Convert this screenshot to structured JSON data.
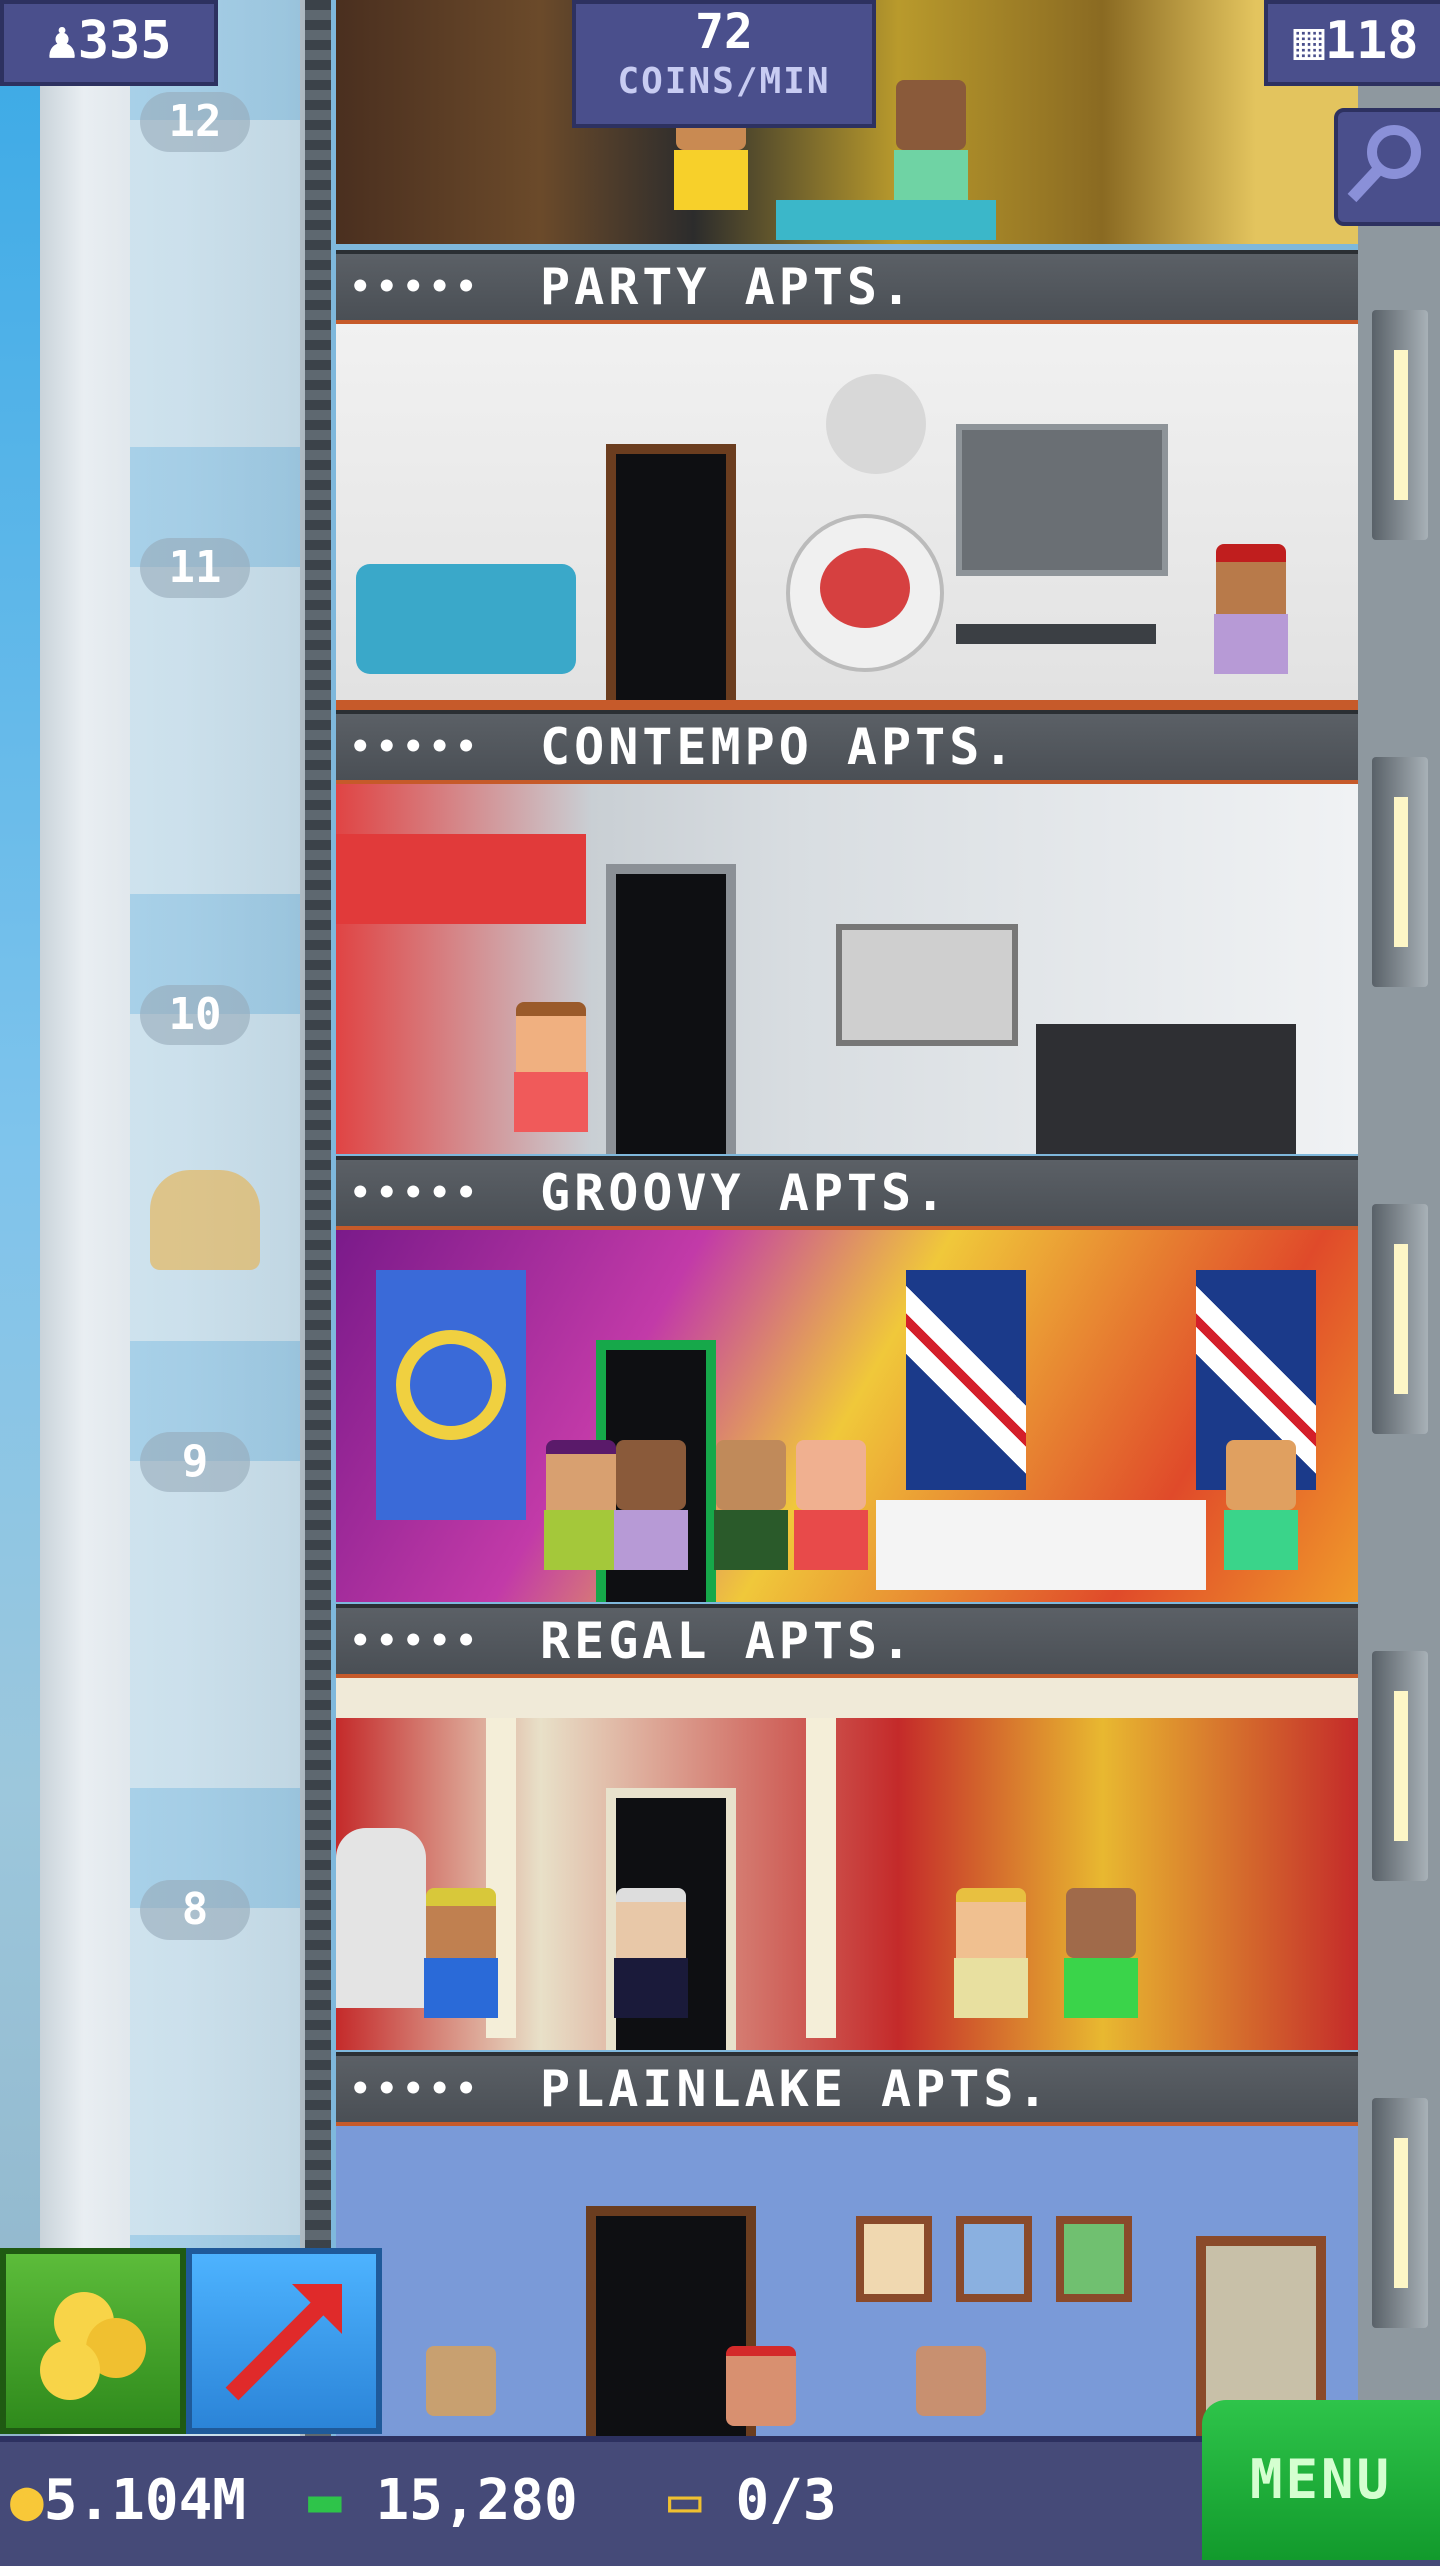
{
  "hud": {
    "population": "335",
    "coins_rate_value": "72",
    "coins_rate_label": "COINS/MIN",
    "floors_count": "118"
  },
  "elevator": {
    "floor_numbers": [
      "12",
      "11",
      "10",
      "9",
      "8"
    ]
  },
  "floors": [
    {
      "name": "PARTY APTS.",
      "people": "•••••"
    },
    {
      "name": "CONTEMPO APTS.",
      "people": "•••••"
    },
    {
      "name": "GROOVY APTS.",
      "people": "•••••"
    },
    {
      "name": "REGAL APTS.",
      "people": "•••••"
    },
    {
      "name": "PLAINLAKE APTS.",
      "people": "•••••"
    }
  ],
  "bottom_bar": {
    "coins": "5.104M",
    "bux": "15,280",
    "vip": "0/3",
    "menu_label": "MENU"
  },
  "colors": {
    "hud_bg": "#4a4f8c",
    "menu_green": "#2ec44a",
    "banner_gray": "#5b6066"
  }
}
